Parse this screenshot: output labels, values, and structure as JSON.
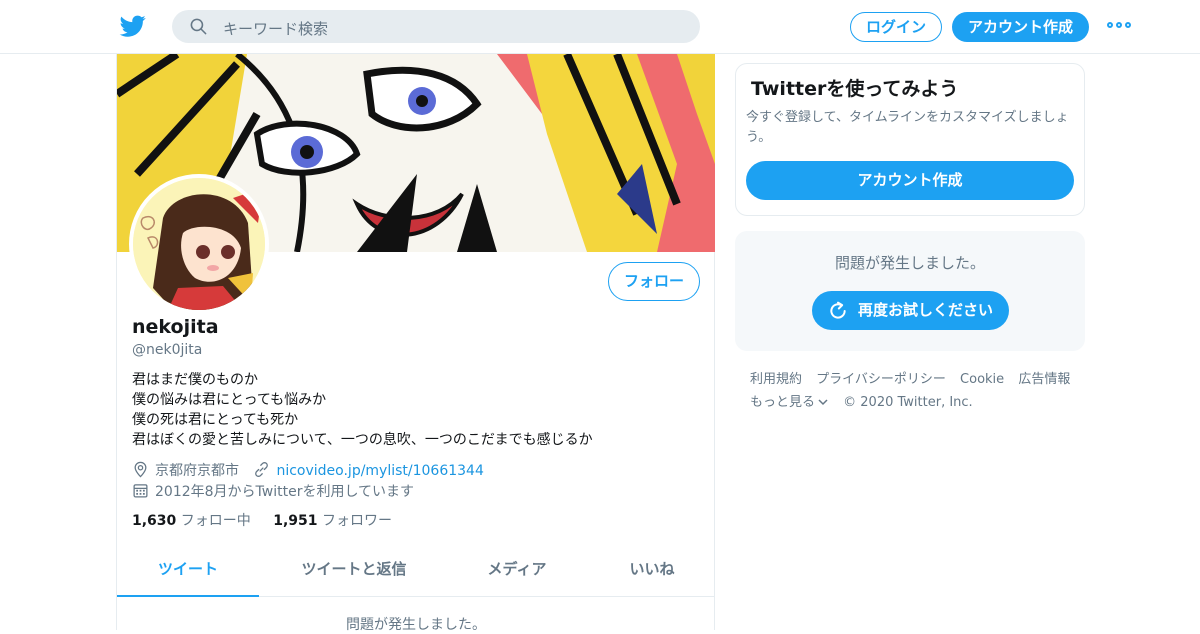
{
  "header": {
    "search_placeholder": "キーワード検索",
    "login_label": "ログイン",
    "signup_label": "アカウント作成",
    "accent_color": "#1da1f2",
    "logo_icon": "twitter-bird-icon",
    "more_icon": "more-dots-icon"
  },
  "profile": {
    "follow_label": "フォロー",
    "name": "nekojita",
    "handle": "@nek0jita",
    "bio": [
      "君はまだ僕のものか",
      "僕の悩みは君にとっても悩みか",
      "僕の死は君にとっても死か",
      "君はぼくの愛と苦しみについて、一つの息吹、一つのこだまでも感じるか"
    ],
    "location": "京都府京都市",
    "url": "nicovideo.jp/mylist/10661344",
    "joined": "2012年8月からTwitterを利用しています",
    "following_count": "1,630",
    "following_label": "フォロー中",
    "followers_count": "1,951",
    "followers_label": "フォロワー"
  },
  "tabs": [
    {
      "label": "ツイート",
      "active": true
    },
    {
      "label": "ツイートと返信",
      "active": false
    },
    {
      "label": "メディア",
      "active": false
    },
    {
      "label": "いいね",
      "active": false
    }
  ],
  "timeline": {
    "error_text": "問題が発生しました。"
  },
  "sidebar": {
    "signup_card": {
      "title": "Twitterを使ってみよう",
      "description": "今すぐ登録して、タイムラインをカスタマイズしましょう。",
      "button_label": "アカウント作成"
    },
    "error_card": {
      "message": "問題が発生しました。",
      "retry_label": "再度お試しください"
    },
    "footer_links": [
      "利用規約",
      "プライバシーポリシー",
      "Cookie",
      "広告情報"
    ],
    "more_label": "もっと見る",
    "copyright": "© 2020 Twitter, Inc."
  }
}
